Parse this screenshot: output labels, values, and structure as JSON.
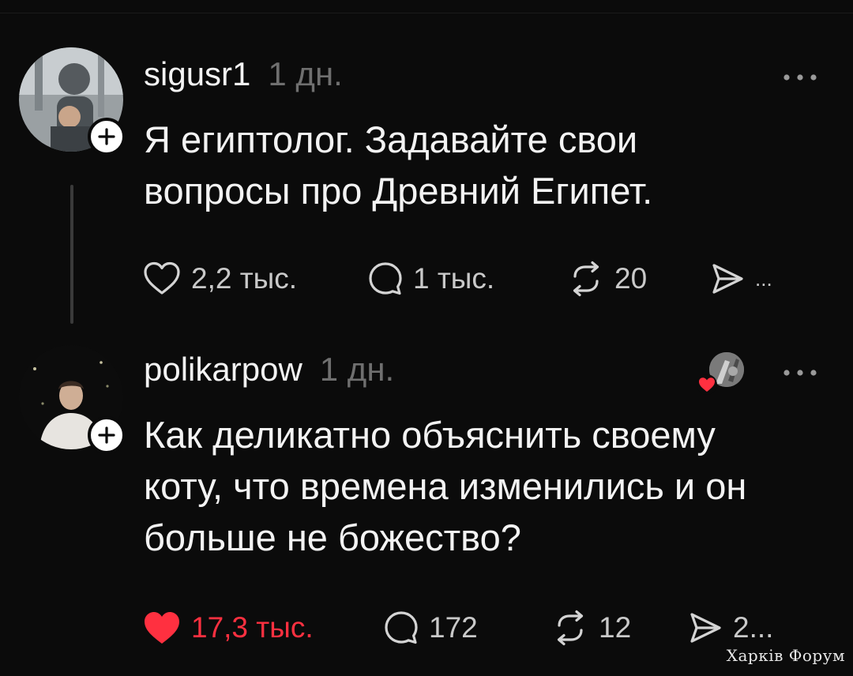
{
  "posts": [
    {
      "username": "sigusr1",
      "time": "1 дн.",
      "text": "Я египтолог. Задавайте свои\nвопросы про Древний Египет.",
      "avatar_icon": "person-photo-avatar",
      "actions": {
        "likes": "2,2 тыс.",
        "replies": "1 тыс.",
        "reposts": "20",
        "shares": "..."
      }
    },
    {
      "username": "polikarpow",
      "time": "1 дн.",
      "text": "Как деликатно объяснить своему\nкоту, что времена изменились и он\nбольше не божество?",
      "avatar_icon": "person-photo-avatar",
      "actions": {
        "likes": "17,3 тыс.",
        "replies": "172",
        "reposts": "12",
        "shares": "2..."
      }
    }
  ],
  "colors": {
    "background": "#0b0b0b",
    "text": "#f3f3f3",
    "muted": "#6f6f6f",
    "like_active": "#ff3040"
  },
  "watermark": "Харків Форум"
}
